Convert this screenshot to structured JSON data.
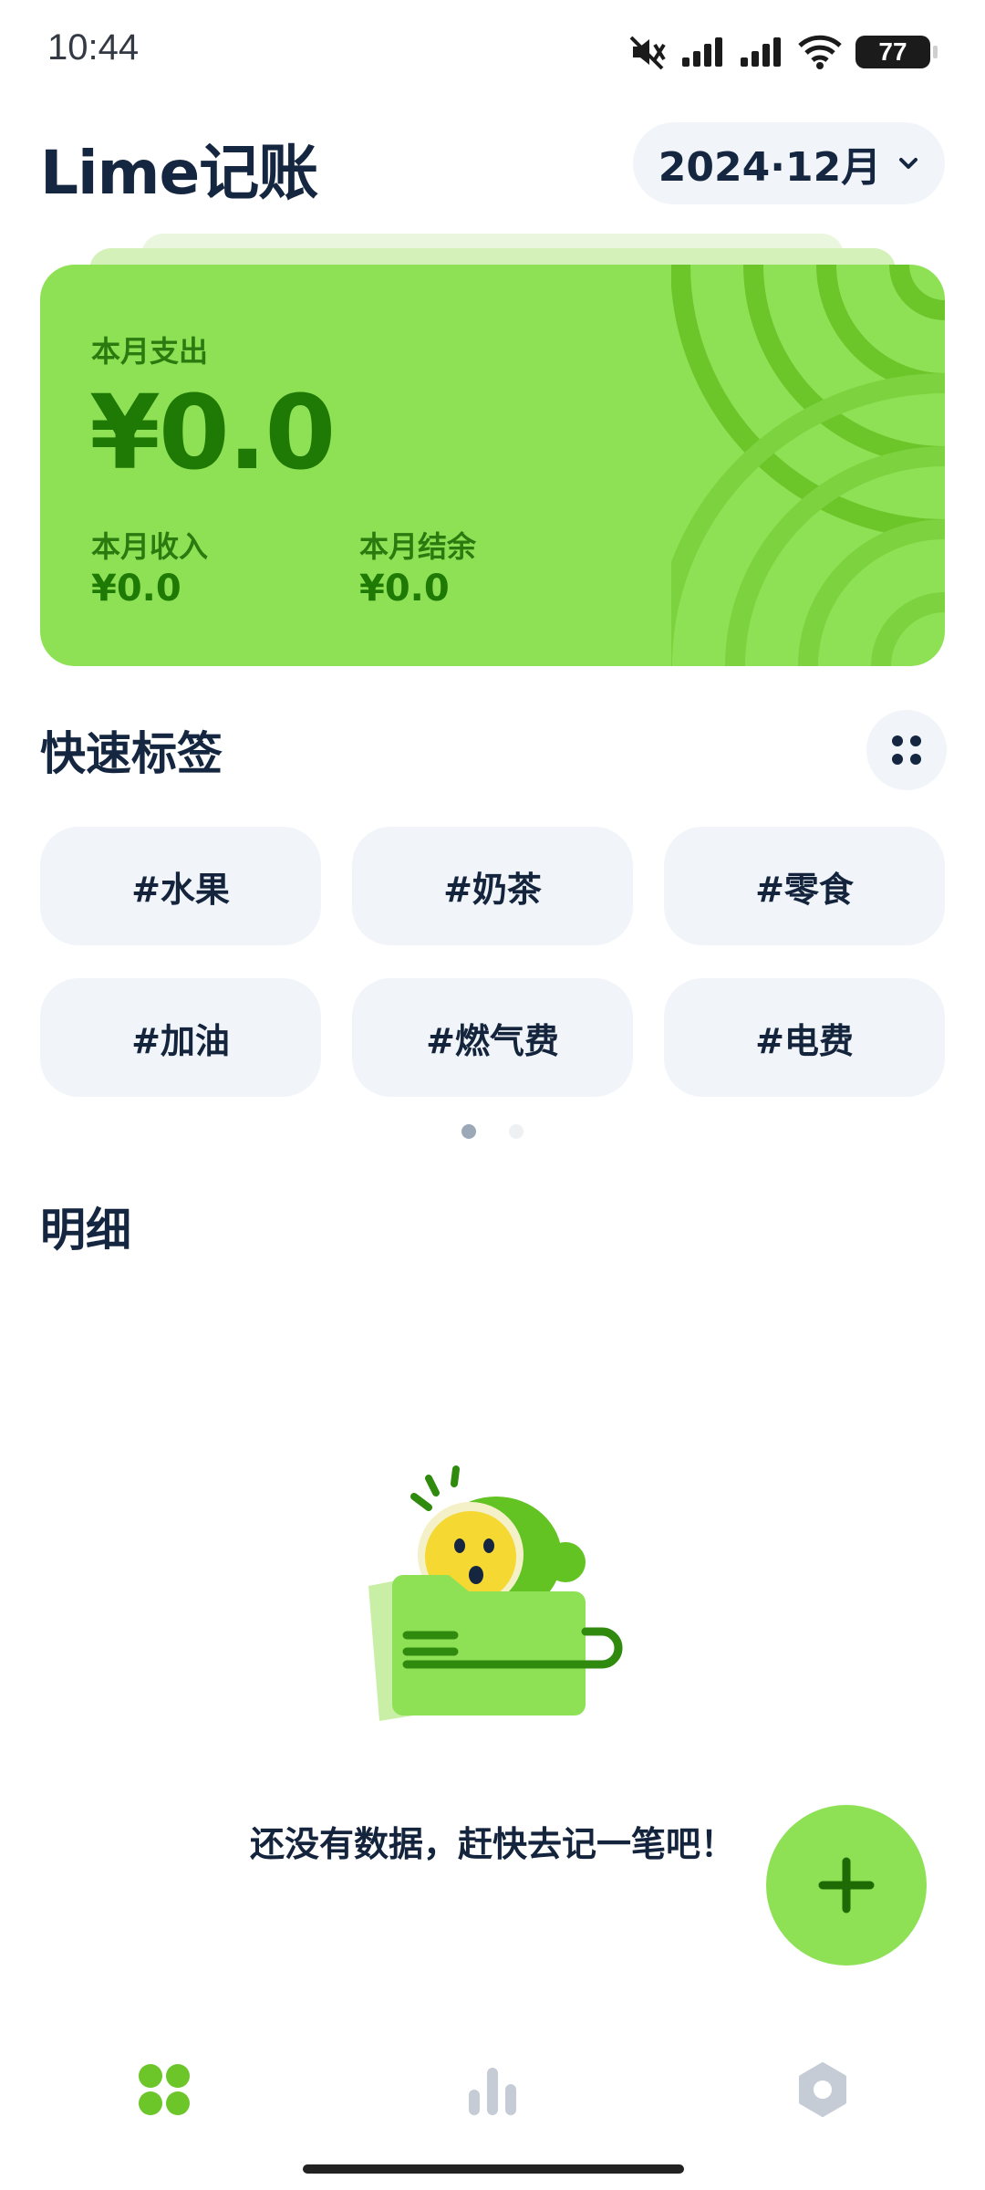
{
  "status_bar": {
    "time": "10:44",
    "icons": [
      "mute-icon",
      "signal-icon",
      "signal-icon",
      "wifi-icon"
    ],
    "battery": "77"
  },
  "header": {
    "title": "Lime记账",
    "month": "2024·12月"
  },
  "summary": {
    "expense_label": "本月支出",
    "expense_value": "¥0.0",
    "income_label": "本月收入",
    "income_value": "¥0.0",
    "balance_label": "本月结余",
    "balance_value": "¥0.0"
  },
  "quick_tags": {
    "title": "快速标签",
    "tags": [
      "#水果",
      "#奶茶",
      "#零食",
      "#加油",
      "#燃气费",
      "#电费"
    ],
    "page_count": 2,
    "active_page": 1
  },
  "details": {
    "title": "明细",
    "empty_text": "还没有数据，赶快去记一笔吧！"
  },
  "nav": {
    "items": [
      "home-icon",
      "stats-icon",
      "settings-icon"
    ],
    "active": "home-icon"
  },
  "colors": {
    "accent": "#8ee155",
    "accent_dark": "#1e7a05",
    "text": "#15243d",
    "chip_bg": "#f1f5f9"
  }
}
